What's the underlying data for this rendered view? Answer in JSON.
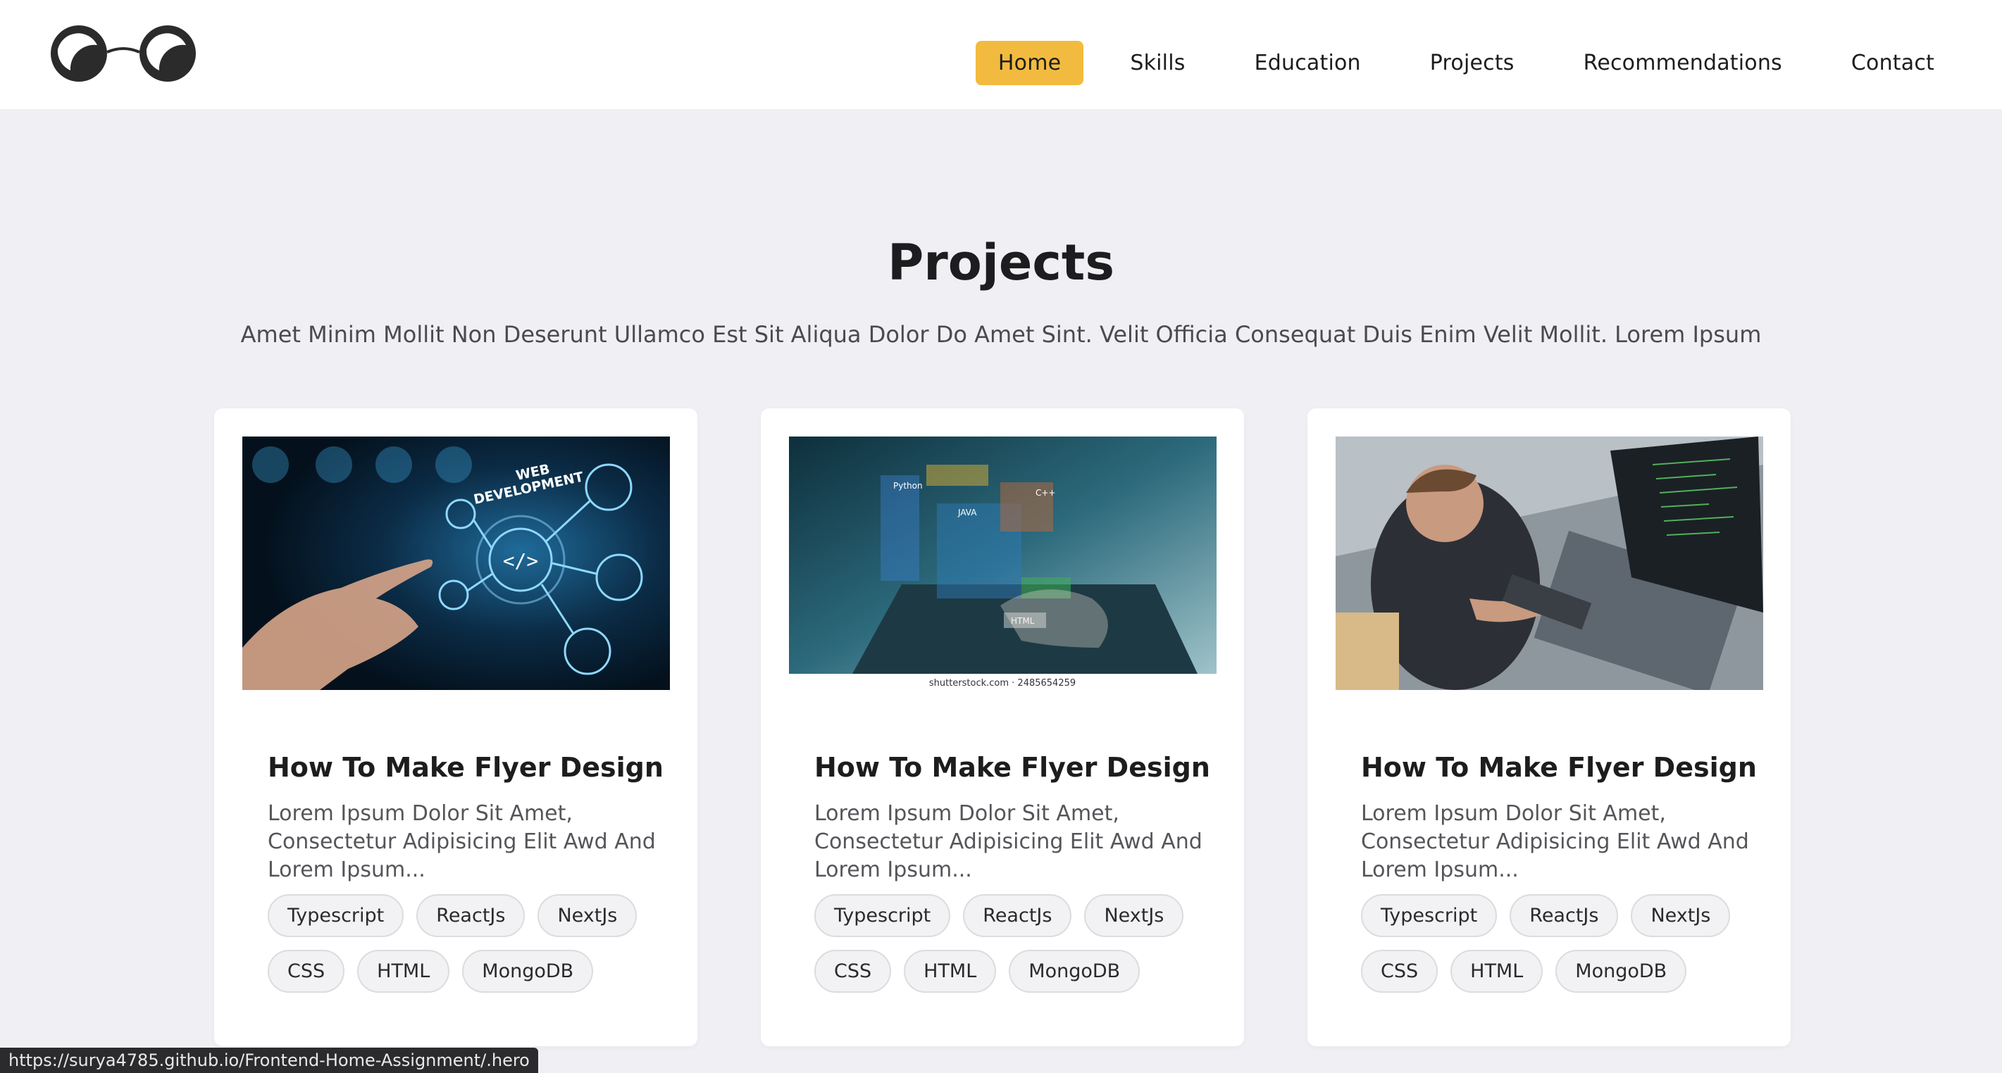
{
  "header": {
    "nav": [
      {
        "label": "Home",
        "active": true
      },
      {
        "label": "Skills",
        "active": false
      },
      {
        "label": "Education",
        "active": false
      },
      {
        "label": "Projects",
        "active": false
      },
      {
        "label": "Recommendations",
        "active": false
      },
      {
        "label": "Contact",
        "active": false
      }
    ]
  },
  "projects": {
    "title": "Projects",
    "subtitle": "Amet Minim Mollit Non Deserunt Ullamco Est Sit Aliqua Dolor Do Amet Sint. Velit Officia Consequat Duis Enim Velit Mollit. Lorem Ipsum",
    "cards": [
      {
        "image": "web-development-photo",
        "image_text": [
          "WEB",
          "DEVELOPMENT"
        ],
        "title": "How To Make Flyer Design",
        "description": "Lorem Ipsum Dolor Sit Amet, Consectetur Adipisicing Elit Awd And Lorem Ipsum...",
        "tags": [
          "Typescript",
          "ReactJs",
          "NextJs",
          "CSS",
          "HTML",
          "MongoDB"
        ]
      },
      {
        "image": "laptop-code-hologram-photo",
        "image_text": [
          "Python",
          "JAVA",
          "C++",
          "HTML",
          "shutterstock.com · 2485654259"
        ],
        "title": "How To Make Flyer Design",
        "description": "Lorem Ipsum Dolor Sit Amet, Consectetur Adipisicing Elit Awd And Lorem Ipsum...",
        "tags": [
          "Typescript",
          "ReactJs",
          "NextJs",
          "CSS",
          "HTML",
          "MongoDB"
        ]
      },
      {
        "image": "developer-at-desk-photo",
        "title": "How To Make Flyer Design",
        "description": "Lorem Ipsum Dolor Sit Amet, Consectetur Adipisicing Elit Awd And Lorem Ipsum...",
        "tags": [
          "Typescript",
          "ReactJs",
          "NextJs",
          "CSS",
          "HTML",
          "MongoDB"
        ]
      }
    ]
  },
  "status_bar": {
    "url": "https://surya4785.github.io/Frontend-Home-Assignment/.hero"
  },
  "colors": {
    "accent": "#f2bb3f",
    "background": "#f0f0f4",
    "card": "#ffffff",
    "text": "#1d1d1f"
  }
}
